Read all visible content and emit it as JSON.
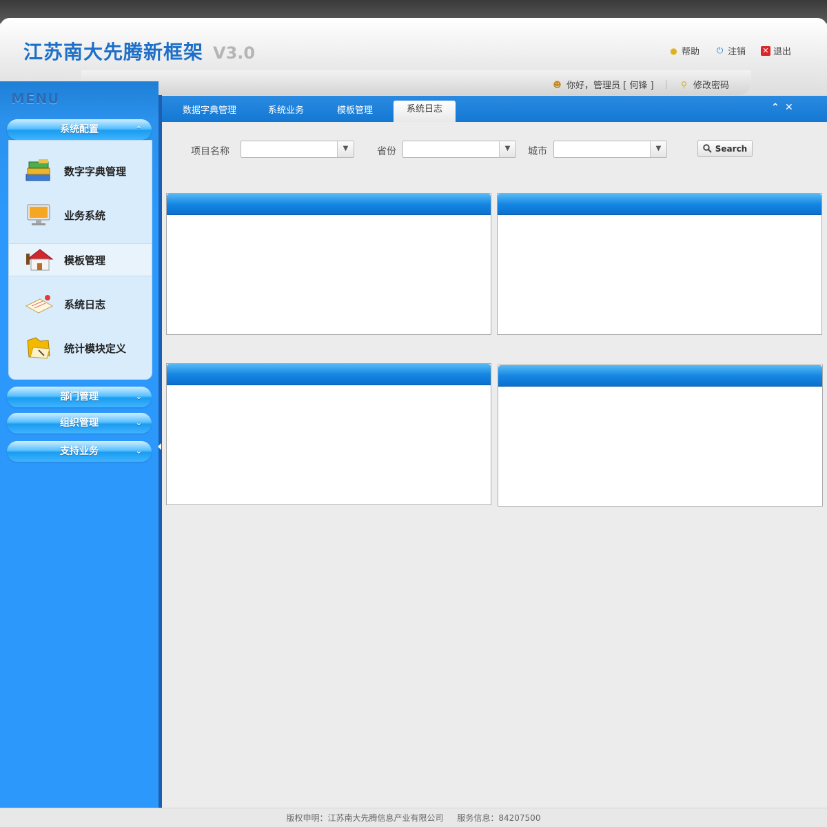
{
  "header": {
    "brand": "江苏南大先腾新框架",
    "version": "V3.0",
    "links": [
      {
        "label": "帮助",
        "icon": "help-bulb-icon"
      },
      {
        "label": "注销",
        "icon": "power-icon"
      },
      {
        "label": "退出",
        "icon": "exit-icon"
      }
    ]
  },
  "userbar": {
    "greeting": "你好，管理员 [ 何锋 ]",
    "change_password": "修改密码"
  },
  "sidebar": {
    "menu_title": "MENU",
    "groups": [
      {
        "label": "系统配置",
        "expanded": true
      },
      {
        "label": "部门管理",
        "expanded": false
      },
      {
        "label": "组织管理",
        "expanded": false
      },
      {
        "label": "支持业务",
        "expanded": false
      }
    ],
    "items": [
      {
        "label": "数字字典管理",
        "icon": "books-icon"
      },
      {
        "label": "业务系统",
        "icon": "monitor-icon"
      },
      {
        "label": "模板管理",
        "icon": "house-icon",
        "active": true
      },
      {
        "label": "系统日志",
        "icon": "notebook-icon"
      },
      {
        "label": "统计模块定义",
        "icon": "folder-icon"
      }
    ]
  },
  "tabs": [
    {
      "label": "数据字典管理"
    },
    {
      "label": "系统业务"
    },
    {
      "label": "模板管理"
    },
    {
      "label": "系统日志",
      "active": true
    }
  ],
  "filters": {
    "project_label": "项目名称",
    "project_value": "",
    "province_label": "省份",
    "province_value": "",
    "city_label": "城市",
    "city_value": "",
    "search_label": "Search"
  },
  "footer": {
    "copyright": "版权申明：江苏南大先腾信息产业有限公司",
    "service": "服务信息：84207500"
  },
  "colors": {
    "accent": "#1478d3",
    "sidebar": "#2c98fc",
    "brand": "#1d6fc7"
  }
}
